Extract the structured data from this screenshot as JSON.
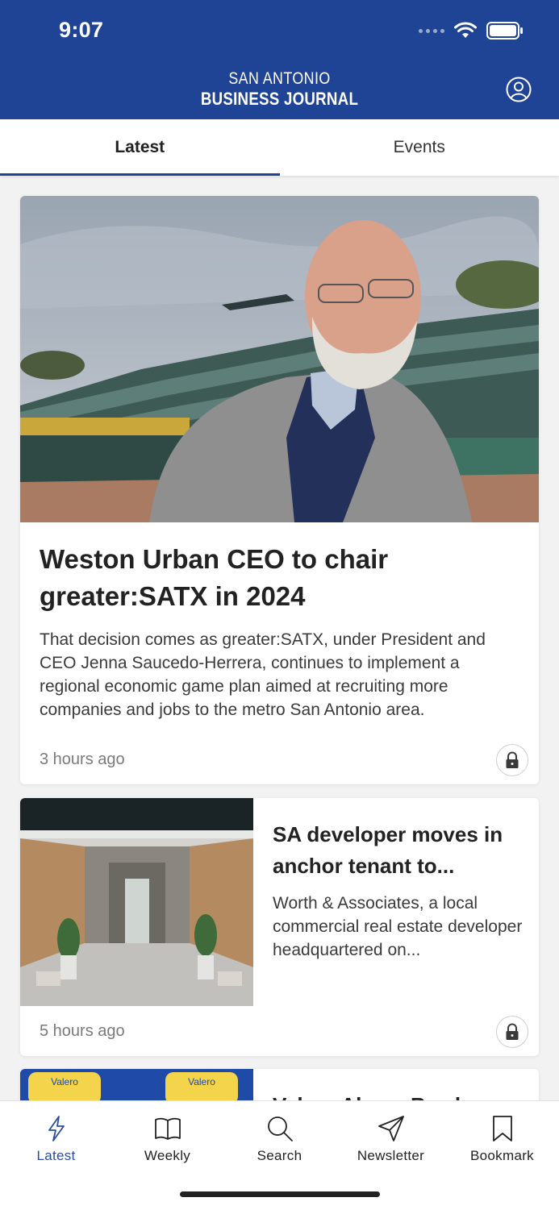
{
  "status": {
    "time": "9:07"
  },
  "header": {
    "brand_line1": "SAN ANTONIO",
    "brand_line2": "BUSINESS JOURNAL"
  },
  "tabs": [
    {
      "label": "Latest",
      "active": true
    },
    {
      "label": "Events",
      "active": false
    }
  ],
  "articles": [
    {
      "title": "Weston Urban CEO to chair greater:SATX in 2024",
      "description": "That decision comes as greater:SATX, under President and CEO Jenna Saucedo-Herrera, continues to implement a regional economic game plan aimed at recruiting more companies and jobs to the metro San Antonio area.",
      "time": "3 hours ago",
      "locked": true
    },
    {
      "title": "SA developer moves in anchor tenant to...",
      "description": "Worth & Associates, a local commercial real estate developer headquartered on...",
      "time": "5 hours ago",
      "locked": true
    },
    {
      "title": "Valero Alamo Bowl",
      "image_text": "Valero"
    }
  ],
  "bottom_nav": [
    {
      "label": "Latest",
      "icon": "bolt-icon",
      "active": true
    },
    {
      "label": "Weekly",
      "icon": "book-icon",
      "active": false
    },
    {
      "label": "Search",
      "icon": "search-icon",
      "active": false
    },
    {
      "label": "Newsletter",
      "icon": "send-icon",
      "active": false
    },
    {
      "label": "Bookmark",
      "icon": "bookmark-icon",
      "active": false
    }
  ],
  "colors": {
    "brand": "#1f4495",
    "active_nav": "#2a4d9b"
  }
}
